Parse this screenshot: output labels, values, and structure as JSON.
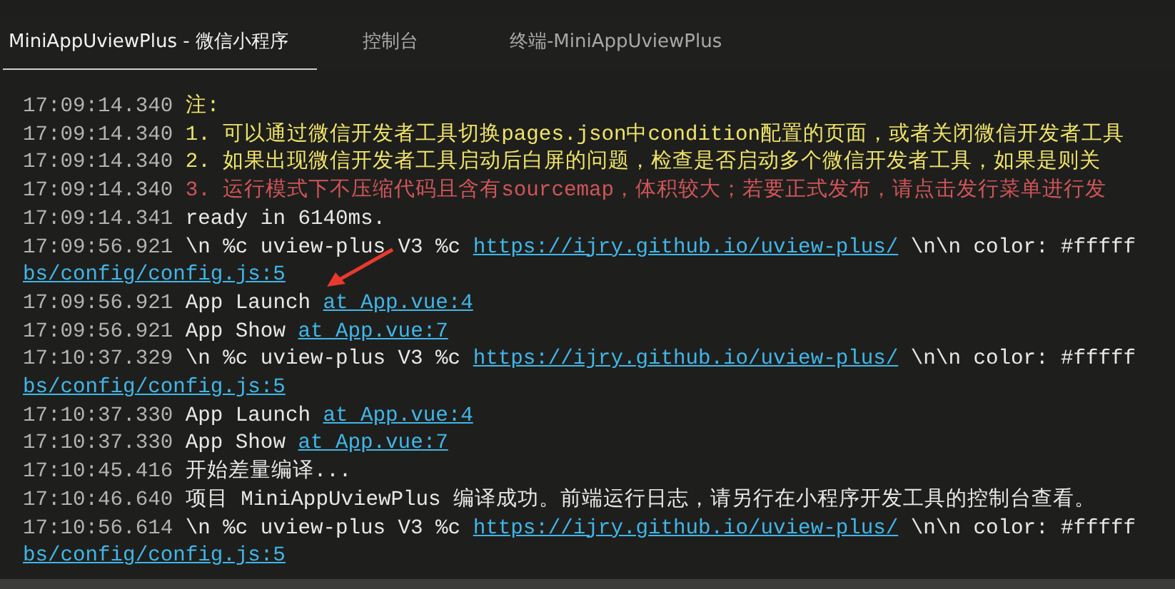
{
  "tabs": [
    {
      "label": "MiniAppUviewPlus - 微信小程序",
      "selected": true
    },
    {
      "label": "控制台",
      "selected": false
    },
    {
      "label": "终端-MiniAppUviewPlus",
      "selected": false
    }
  ],
  "log": [
    {
      "time": "17:09:14.340",
      "segments": [
        {
          "kind": "text",
          "color": "#f0e36a",
          "text": "注:"
        }
      ]
    },
    {
      "time": "17:09:14.340",
      "segments": [
        {
          "kind": "text",
          "color": "#f0e36a",
          "text": "1. 可以通过微信开发者工具切换pages.json中condition配置的页面，或者关闭微信开发者工具"
        }
      ]
    },
    {
      "time": "17:09:14.340",
      "segments": [
        {
          "kind": "text",
          "color": "#f0e36a",
          "text": "2. 如果出现微信开发者工具启动后白屏的问题，检查是否启动多个微信开发者工具，如果是则关"
        }
      ]
    },
    {
      "time": "17:09:14.340",
      "segments": [
        {
          "kind": "text",
          "color": "#d0555a",
          "text": "3. 运行模式下不压缩代码且含有sourcemap，体积较大；若要正式发布，请点击发行菜单进行发"
        }
      ]
    },
    {
      "time": "17:09:14.341",
      "segments": [
        {
          "kind": "text",
          "color": "#e8e8e8",
          "text": "ready in 6140ms."
        }
      ]
    },
    {
      "time": "17:09:56.921",
      "segments": [
        {
          "kind": "text",
          "color": "#e8e8e8",
          "text": "\\n %c uview-plus V3 %c"
        },
        {
          "kind": "link",
          "text": "https://ijry.github.io/uview-plus/"
        },
        {
          "kind": "text",
          "color": "#e8e8e8",
          "text": "\\n\\n color: #fffff"
        }
      ]
    },
    {
      "segments": [
        {
          "kind": "link",
          "text": "bs/config/config.js:5"
        }
      ]
    },
    {
      "time": "17:09:56.921",
      "segments": [
        {
          "kind": "text",
          "color": "#e8e8e8",
          "text": "App Launch"
        },
        {
          "kind": "link",
          "text": "at App.vue:4"
        }
      ]
    },
    {
      "time": "17:09:56.921",
      "segments": [
        {
          "kind": "text",
          "color": "#e8e8e8",
          "text": "App Show"
        },
        {
          "kind": "link",
          "text": "at App.vue:7"
        }
      ]
    },
    {
      "time": "17:10:37.329",
      "segments": [
        {
          "kind": "text",
          "color": "#e8e8e8",
          "text": "\\n %c uview-plus V3 %c"
        },
        {
          "kind": "link",
          "text": "https://ijry.github.io/uview-plus/"
        },
        {
          "kind": "text",
          "color": "#e8e8e8",
          "text": "\\n\\n color: #fffff"
        }
      ]
    },
    {
      "segments": [
        {
          "kind": "link",
          "text": "bs/config/config.js:5"
        }
      ]
    },
    {
      "time": "17:10:37.330",
      "segments": [
        {
          "kind": "text",
          "color": "#e8e8e8",
          "text": "App Launch"
        },
        {
          "kind": "link",
          "text": "at App.vue:4"
        }
      ]
    },
    {
      "time": "17:10:37.330",
      "segments": [
        {
          "kind": "text",
          "color": "#e8e8e8",
          "text": "App Show"
        },
        {
          "kind": "link",
          "text": "at App.vue:7"
        }
      ]
    },
    {
      "time": "17:10:45.416",
      "segments": [
        {
          "kind": "text",
          "color": "#e8e8e8",
          "text": "开始差量编译..."
        }
      ]
    },
    {
      "time": "17:10:46.640",
      "segments": [
        {
          "kind": "text",
          "color": "#e8e8e8",
          "text": "项目 MiniAppUviewPlus 编译成功。前端运行日志，请另行在小程序开发工具的控制台查看。"
        }
      ]
    },
    {
      "time": "17:10:56.614",
      "segments": [
        {
          "kind": "text",
          "color": "#e8e8e8",
          "text": "\\n %c uview-plus V3 %c"
        },
        {
          "kind": "link",
          "text": "https://ijry.github.io/uview-plus/"
        },
        {
          "kind": "text",
          "color": "#e8e8e8",
          "text": "\\n\\n color: #fffff"
        }
      ]
    },
    {
      "segments": [
        {
          "kind": "link",
          "text": "bs/config/config.js:5"
        }
      ]
    }
  ]
}
